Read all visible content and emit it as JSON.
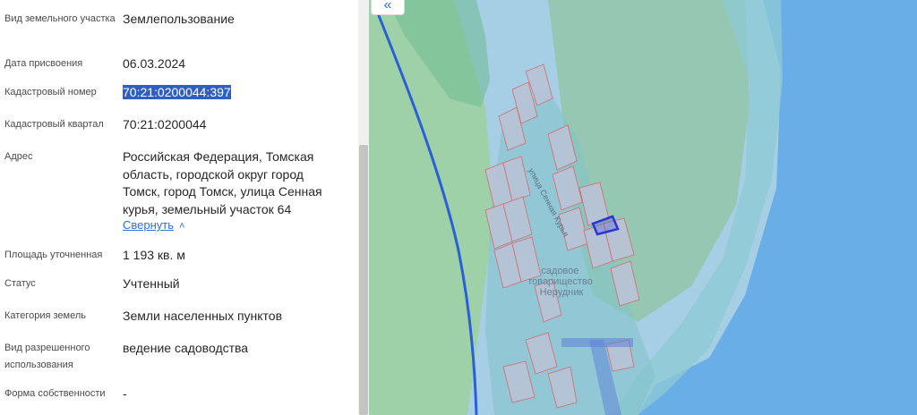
{
  "panel": {
    "land_type": {
      "label": "Вид земельного участка",
      "value": "Землепользование"
    },
    "assigned_date": {
      "label": "Дата присвоения",
      "value": "06.03.2024"
    },
    "cadastral_number": {
      "label": "Кадастровый номер",
      "value": "70:21:0200044:397"
    },
    "cadastral_quarter": {
      "label": "Кадастровый квартал",
      "value": "70:21:0200044"
    },
    "address": {
      "label": "Адрес",
      "lines": [
        "Российская Федерация, Томская",
        "область, городской округ город",
        "Томск, город Томск, улица Сенная",
        "курья, земельный участок 64"
      ],
      "collapse_label": "Свернуть"
    },
    "area": {
      "label": "Площадь уточненная",
      "value": "1 193 кв. м"
    },
    "status": {
      "label": "Статус",
      "value": "Учтенный"
    },
    "category": {
      "label": "Категория земель",
      "value": "Земли населенных пунктов"
    },
    "permitted_use": {
      "label": "Вид разрешенного использования",
      "value": "ведение садоводства"
    },
    "ownership": {
      "label": "Форма собственности",
      "value": "-"
    }
  },
  "map": {
    "street_label": "улица Сенная Курья",
    "area_label_lines": [
      "садовое",
      "товарищество",
      "Нерудник"
    ],
    "colors": {
      "water": "#6aaee8",
      "shallow": "#a6cfe6",
      "meadow": "#9fd1a8",
      "island": "#95c7b3",
      "plot_fill": "#b9c2d6",
      "plot_border": "#d56b6b",
      "selected": "#2a36d4",
      "boundary": "#2a5fd8"
    }
  },
  "ui": {
    "collapse_icon": "«"
  }
}
